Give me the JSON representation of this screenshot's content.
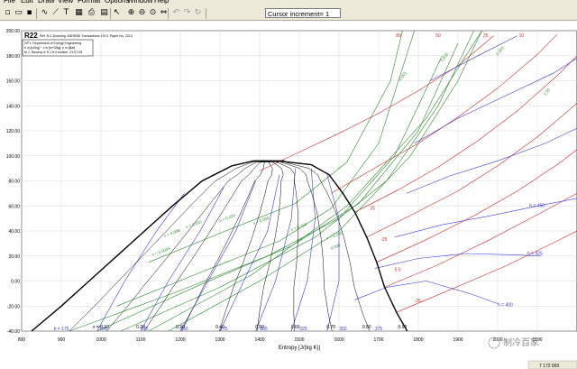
{
  "menu": [
    "File",
    "Edit",
    "Draw",
    "View",
    "Format",
    "Options",
    "Window",
    "Help"
  ],
  "toolbar": {
    "icons": [
      "new-icon",
      "open-icon",
      "save-icon",
      "curve-tool-icon",
      "line-tool-icon",
      "text-tool-icon",
      "grid-icon",
      "print-icon",
      "chart-icon",
      "cursor-icon",
      "zoom-in-icon",
      "zoom-out-icon",
      "zoom-extents-icon",
      "pan-icon",
      "undo-icon",
      "redo-icon",
      "refresh-icon"
    ],
    "cursor_increment": "Cursor increment= 1"
  },
  "status": {
    "value": "7 172 000"
  },
  "colors": {
    "vapor_dome": "#000000",
    "isobars": "#3b3bdc",
    "isochores": "#2e8b2e",
    "isotherms": "#d62828",
    "quality_lines": "#000000",
    "frame": "#ece9d8"
  },
  "watermark": {
    "text": "制冷百家"
  },
  "chart_data": {
    "type": "line",
    "title": "R22",
    "subtitle": "Ref: R.C.Downing. ASHRAE Transactions 1974. Paper No. 2313",
    "info_box": [
      "IVF1, Department of Energy Engineering",
      "h in [kJ/kg] ~ v in [m^3/kg], p in [Bar]",
      "M.J. Skovrup & H.J.H Knudsen. 21-07-05"
    ],
    "xlabel": "Entropy [J/(kg K)]",
    "ylabel": "",
    "xlim": [
      800,
      2200
    ],
    "ylim": [
      -40,
      200
    ],
    "xticks": [
      800,
      900,
      1000,
      1100,
      1200,
      1300,
      1400,
      1500,
      1600,
      1700,
      1800,
      1900,
      2000,
      2100
    ],
    "yticks": [
      "200.00",
      "180.00",
      "160.00",
      "140.00",
      "120.00",
      "100.00",
      "80.00",
      "60.00",
      "40.00",
      "20.00",
      "0.00",
      "-20.00",
      "-40.00"
    ],
    "critical_point": {
      "s": 1462,
      "T": 96
    },
    "saturation_liquid": [
      [
        825,
        -40
      ],
      [
        900,
        -20
      ],
      [
        970,
        0
      ],
      [
        1040,
        20
      ],
      [
        1110,
        40
      ],
      [
        1180,
        60
      ],
      [
        1255,
        80
      ],
      [
        1330,
        92
      ],
      [
        1385,
        96
      ]
    ],
    "saturation_vapor": [
      [
        1445,
        96
      ],
      [
        1530,
        93
      ],
      [
        1575,
        85
      ],
      [
        1610,
        70
      ],
      [
        1640,
        55
      ],
      [
        1670,
        35
      ],
      [
        1695,
        15
      ],
      [
        1715,
        -5
      ],
      [
        1745,
        -25
      ],
      [
        1772,
        -40
      ]
    ],
    "quality_labels": [
      "x = 0.10",
      "0.20",
      "0.30",
      "0.40",
      "0.50",
      "0.60",
      "0.70",
      "0.80",
      "0.90"
    ],
    "quality_label_s": [
      1000,
      1100,
      1200,
      1300,
      1400,
      1490,
      1580,
      1670,
      1760
    ],
    "enthalpy_labels": [
      "h = 175",
      "200",
      "225",
      "250",
      "275",
      "300",
      "325",
      "350",
      "375"
    ],
    "enthalpy_label_s": [
      900,
      1005,
      1110,
      1210,
      1310,
      1410,
      1510,
      1610,
      1700
    ],
    "isochore_labels": [
      "v = 0.0005",
      "v = 0.008",
      "v = 0.010",
      "v = 0.025",
      "v = 0.050",
      "v = 0.100",
      "v = 0.200",
      "0.500"
    ],
    "isochore_label_pts": [
      [
        1130,
        20
      ],
      [
        1160,
        35
      ],
      [
        1215,
        42
      ],
      [
        1300,
        47
      ],
      [
        1385,
        45
      ],
      [
        1480,
        40
      ],
      [
        1570,
        33
      ],
      [
        1580,
        25
      ]
    ],
    "isobar_labels": [
      "h = 450",
      "h = 425",
      "h = 400"
    ],
    "isobar_label_pts": [
      [
        2080,
        59
      ],
      [
        2075,
        21
      ],
      [
        2000,
        -20
      ]
    ],
    "isotherm_top_labels": [
      "80",
      "50",
      "25",
      "10"
    ],
    "isotherm_top_s": [
      1750,
      1850,
      1970,
      2060
    ],
    "isotherm_side_labels": [
      "25",
      "-25",
      "5.0",
      "-25"
    ],
    "isotherm_side_pts": [
      [
        1678,
        57
      ],
      [
        1705,
        32
      ],
      [
        1740,
        8
      ],
      [
        1790,
        -17
      ]
    ],
    "top_right_labels": [
      "0.001",
      "0.005",
      "0.050",
      "1.00"
    ],
    "top_right_pts": [
      [
        1755,
        160
      ],
      [
        1860,
        175
      ],
      [
        2000,
        180
      ],
      [
        2120,
        148
      ]
    ]
  }
}
